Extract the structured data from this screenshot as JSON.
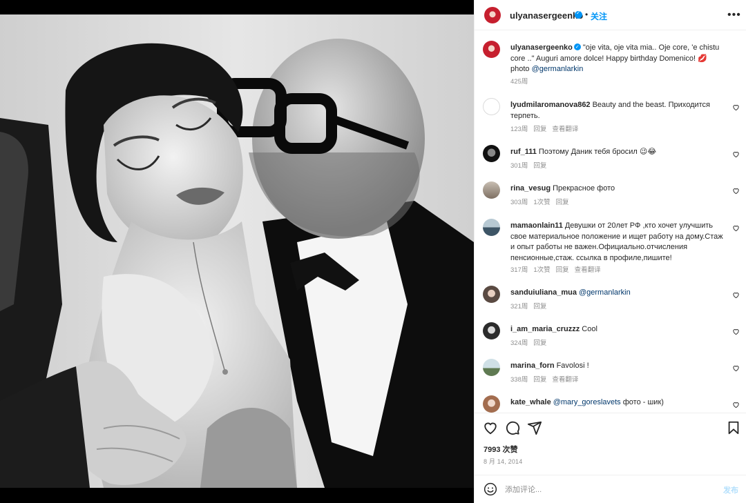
{
  "post": {
    "author": "ulyanasergeenko",
    "separator": "•",
    "follow_label": "关注",
    "more_label": "•••",
    "caption_text": "\"oje vita, oje vita mia.. Oje core, 'e chistu core ..\" Auguri amore dolce! Happy birthday Domenico! 💋 photo ",
    "caption_mention": "@germanlarkin",
    "caption_time": "425周",
    "likes": "7993 次赞",
    "date": "8 月 14, 2014"
  },
  "comments": [
    {
      "user": "lyudmilaromanova862",
      "text": "Beauty and the beast. Приходится терпеть.",
      "time": "123周",
      "likes": "",
      "reply": "回复",
      "translate": "查看翻译"
    },
    {
      "user": "ruf_111",
      "text": "Поэтому Даник тебя бросил 😉😂",
      "time": "301周",
      "likes": "",
      "reply": "回复",
      "translate": ""
    },
    {
      "user": "rina_vesug",
      "text": "Прекрасное фото",
      "time": "303周",
      "likes": "1次赞",
      "reply": "回复",
      "translate": ""
    },
    {
      "user": "mamaonlain11",
      "text": "Девушки от 20лет РФ ,кто хочет улучшить свое материальное положение и ищет работу на дому.Стаж и опыт работы не важен.Официально.отчисления пенсионные,стаж. ссылка в профиле,пишите!",
      "time": "317周",
      "likes": "1次赞",
      "reply": "回复",
      "translate": "查看翻译"
    },
    {
      "user": "sanduiuliana_mua",
      "text": "",
      "mention": "@germanlarkin",
      "time": "321周",
      "likes": "",
      "reply": "回复",
      "translate": ""
    },
    {
      "user": "i_am_maria_cruzzz",
      "text": "Cool",
      "time": "324周",
      "likes": "",
      "reply": "回复",
      "translate": ""
    },
    {
      "user": "marina_forn",
      "text": "Favolosi !",
      "time": "338周",
      "likes": "",
      "reply": "回复",
      "translate": "查看翻译"
    },
    {
      "user": "kate_whale",
      "text": " фото - шик)",
      "mention": "@mary_goreslavets",
      "time": "",
      "likes": "",
      "reply": "",
      "translate": ""
    }
  ],
  "composer": {
    "placeholder": "添加评论...",
    "post_label": "发布"
  },
  "icons": {
    "like": "heart-icon",
    "comment": "comment-icon",
    "share": "share-icon",
    "save": "bookmark-icon",
    "emoji": "emoji-icon"
  },
  "colors": {
    "link": "#0095f6",
    "mention": "#00376b",
    "muted": "#8e8e8e"
  }
}
